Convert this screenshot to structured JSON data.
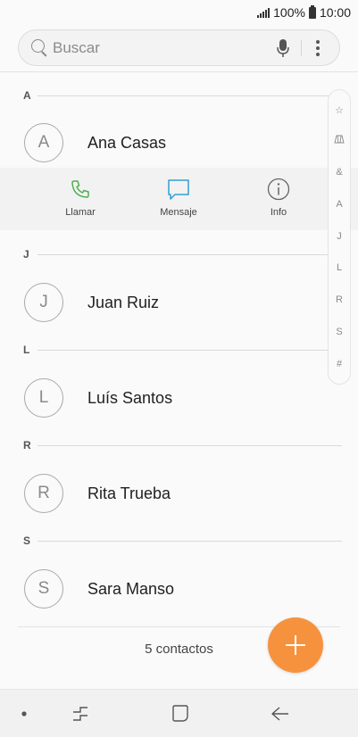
{
  "status_bar": {
    "battery": "100%",
    "time": "10:00"
  },
  "search": {
    "placeholder": "Buscar"
  },
  "sections": [
    {
      "letter": "A",
      "contacts": [
        {
          "initial": "A",
          "name": "Ana Casas"
        }
      ]
    },
    {
      "letter": "J",
      "contacts": [
        {
          "initial": "J",
          "name": "Juan Ruiz"
        }
      ]
    },
    {
      "letter": "L",
      "contacts": [
        {
          "initial": "L",
          "name": "Luís Santos"
        }
      ]
    },
    {
      "letter": "R",
      "contacts": [
        {
          "initial": "R",
          "name": "Rita Trueba"
        }
      ]
    },
    {
      "letter": "S",
      "contacts": [
        {
          "initial": "S",
          "name": "Sara Manso"
        }
      ]
    }
  ],
  "actions": [
    {
      "label": "Llamar",
      "icon": "phone-icon",
      "color": "#4caf50"
    },
    {
      "label": "Mensaje",
      "icon": "message-icon",
      "color": "#2f9fd3"
    },
    {
      "label": "Info",
      "icon": "info-icon",
      "color": "#666666"
    }
  ],
  "index_bar": [
    "☆",
    "icon:group-icon",
    "&",
    "A",
    "J",
    "L",
    "R",
    "S",
    "#"
  ],
  "footer": {
    "count": "5 contactos"
  },
  "fab": {
    "color": "#f6923d",
    "icon": "add-icon"
  },
  "nav": [
    "dot-icon",
    "recent-apps-icon",
    "home-icon",
    "back-icon"
  ]
}
